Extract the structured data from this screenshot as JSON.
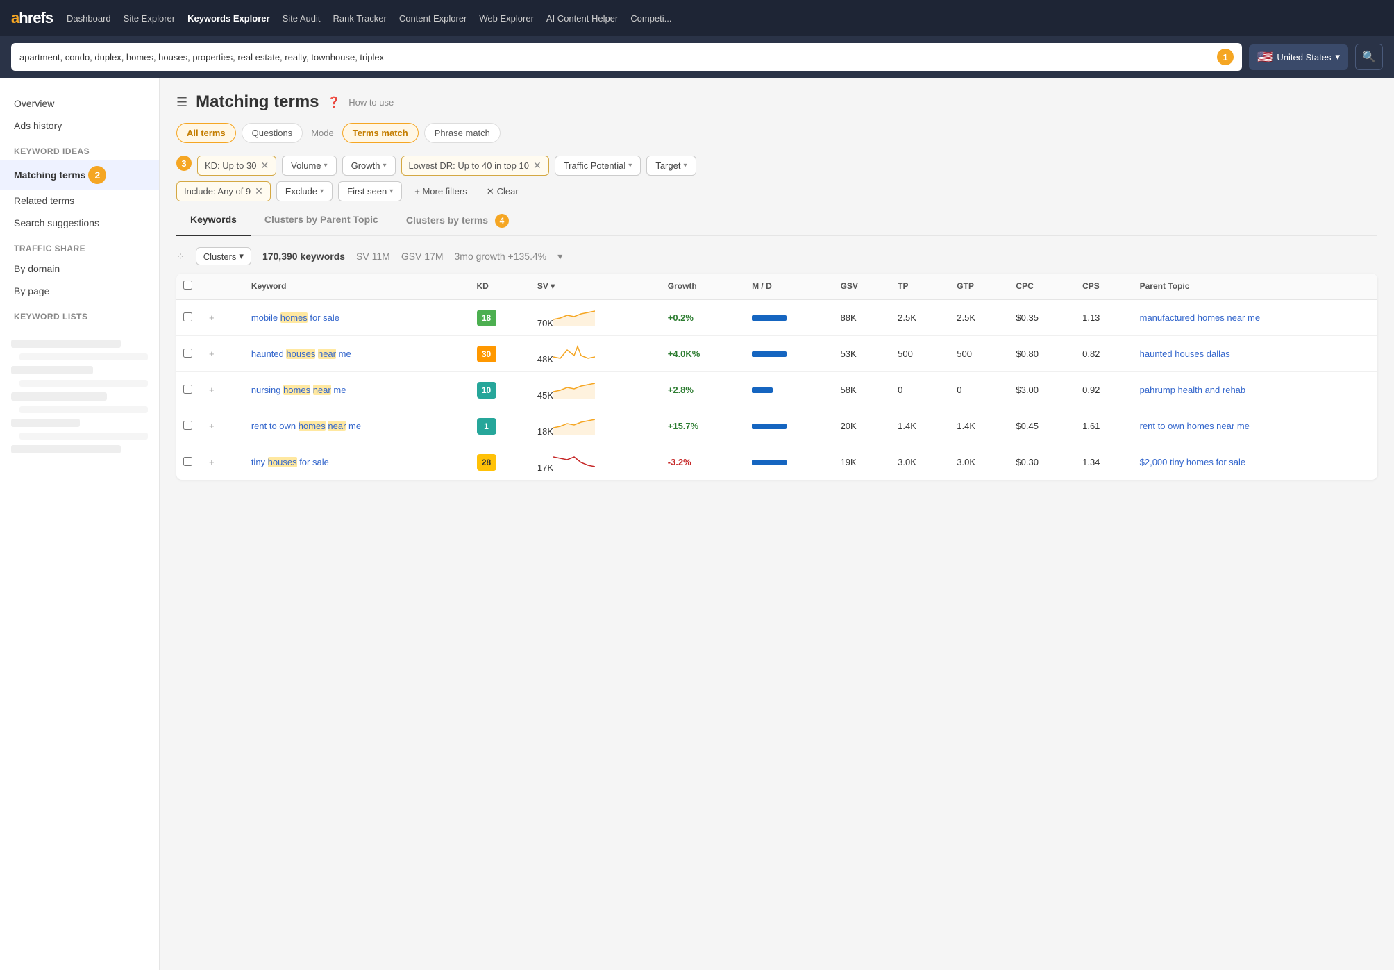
{
  "brand": {
    "name_a": "a",
    "name_rest": "hrefs"
  },
  "nav": {
    "links": [
      {
        "label": "Dashboard",
        "active": false
      },
      {
        "label": "Site Explorer",
        "active": false
      },
      {
        "label": "Keywords Explorer",
        "active": true
      },
      {
        "label": "Site Audit",
        "active": false
      },
      {
        "label": "Rank Tracker",
        "active": false
      },
      {
        "label": "Content Explorer",
        "active": false
      },
      {
        "label": "Web Explorer",
        "active": false
      },
      {
        "label": "AI Content Helper",
        "active": false
      },
      {
        "label": "Competi...",
        "active": false
      }
    ]
  },
  "search": {
    "query": "apartment, condo, duplex, homes, houses, properties, real estate, realty, townhouse, triplex",
    "badge": "1",
    "country": "United States",
    "flag": "🇺🇸"
  },
  "sidebar": {
    "items": [
      {
        "label": "Overview",
        "active": false
      },
      {
        "label": "Ads history",
        "active": false
      }
    ],
    "keyword_ideas_section": "Keyword ideas",
    "keyword_ideas_items": [
      {
        "label": "Matching terms",
        "active": true,
        "badge": "2"
      },
      {
        "label": "Related terms",
        "active": false
      },
      {
        "label": "Search suggestions",
        "active": false
      }
    ],
    "traffic_share_section": "Traffic share",
    "traffic_share_items": [
      {
        "label": "By domain",
        "active": false
      },
      {
        "label": "By page",
        "active": false
      }
    ],
    "keyword_lists_section": "Keyword lists"
  },
  "page": {
    "title": "Matching terms",
    "how_to_use": "How to use",
    "badge2": "2",
    "badge3": "3",
    "badge4": "4"
  },
  "tabs": {
    "items": [
      {
        "label": "All terms",
        "active": true
      },
      {
        "label": "Questions",
        "active": false
      }
    ],
    "mode_label": "Mode",
    "match_tabs": [
      {
        "label": "Terms match",
        "active": true
      },
      {
        "label": "Phrase match",
        "active": false
      }
    ]
  },
  "filters": {
    "kd": "KD: Up to 30",
    "volume_label": "Volume",
    "growth_label": "Growth",
    "lowest_dr": "Lowest DR: Up to 40 in top 10",
    "traffic_potential": "Traffic Potential",
    "target_label": "Target",
    "include": "Include: Any of 9",
    "exclude_label": "Exclude",
    "first_seen_label": "First seen",
    "more_filters": "+ More filters",
    "clear": "Clear"
  },
  "table_tabs": [
    {
      "label": "Keywords",
      "active": true
    },
    {
      "label": "Clusters by Parent Topic",
      "active": false
    },
    {
      "label": "Clusters by terms",
      "active": false
    }
  ],
  "summary": {
    "clusters_label": "Clusters",
    "keywords_count": "170,390 keywords",
    "sv": "SV 11M",
    "gsv": "GSV 17M",
    "growth": "3mo growth +135.4%"
  },
  "table": {
    "headers": [
      "",
      "",
      "Keyword",
      "KD",
      "SV",
      "Growth",
      "M / D",
      "GSV",
      "TP",
      "GTP",
      "CPC",
      "CPS",
      "Parent Topic"
    ],
    "rows": [
      {
        "keyword": "mobile homes for sale",
        "keyword_parts": [
          "mobile ",
          "homes",
          " for sale"
        ],
        "highlight_indices": [
          1
        ],
        "kd": "18",
        "kd_class": "kd-green",
        "sv": "70K",
        "growth": "+0.2%",
        "growth_class": "growth-pos",
        "sparkline_color": "#f5a623",
        "md_bar_width": 50,
        "gsv": "88K",
        "tp": "2.5K",
        "gtp": "2.5K",
        "cpc": "$0.35",
        "cps": "1.13",
        "parent_topic": "manufactured homes near me"
      },
      {
        "keyword": "haunted houses near me",
        "keyword_parts": [
          "haunted ",
          "houses",
          " ",
          "near",
          " me"
        ],
        "highlight_indices": [
          1,
          3
        ],
        "kd": "30",
        "kd_class": "kd-orange",
        "sv": "48K",
        "growth": "+4.0K%",
        "growth_class": "growth-pos",
        "sparkline_color": "#f5a623",
        "md_bar_width": 50,
        "gsv": "53K",
        "tp": "500",
        "gtp": "500",
        "cpc": "$0.80",
        "cps": "0.82",
        "parent_topic": "haunted houses dallas"
      },
      {
        "keyword": "nursing homes near me",
        "keyword_parts": [
          "nursing ",
          "homes",
          " ",
          "near",
          " me"
        ],
        "highlight_indices": [
          1,
          3
        ],
        "kd": "10",
        "kd_class": "kd-teal",
        "sv": "45K",
        "growth": "+2.8%",
        "growth_class": "growth-pos",
        "sparkline_color": "#f5a623",
        "md_bar_width": 30,
        "gsv": "58K",
        "tp": "0",
        "gtp": "0",
        "cpc": "$3.00",
        "cps": "0.92",
        "parent_topic": "pahrump health and rehab"
      },
      {
        "keyword": "rent to own homes near me",
        "keyword_parts": [
          "rent ",
          "to",
          " own ",
          "homes",
          " ",
          "near",
          " me"
        ],
        "highlight_indices": [
          3,
          5
        ],
        "kd": "1",
        "kd_class": "kd-teal",
        "sv": "18K",
        "growth": "+15.7%",
        "growth_class": "growth-pos",
        "sparkline_color": "#f5a623",
        "md_bar_width": 50,
        "gsv": "20K",
        "tp": "1.4K",
        "gtp": "1.4K",
        "cpc": "$0.45",
        "cps": "1.61",
        "parent_topic": "rent to own homes near me"
      },
      {
        "keyword": "tiny houses for sale",
        "keyword_parts": [
          "tiny ",
          "houses",
          " for sale"
        ],
        "highlight_indices": [
          1
        ],
        "kd": "28",
        "kd_class": "kd-yellow",
        "sv": "17K",
        "growth": "-3.2%",
        "growth_class": "growth-neg",
        "sparkline_color": "#c62828",
        "md_bar_width": 50,
        "gsv": "19K",
        "tp": "3.0K",
        "gtp": "3.0K",
        "cpc": "$0.30",
        "cps": "1.34",
        "parent_topic": "$2,000 tiny homes for sale"
      }
    ]
  }
}
